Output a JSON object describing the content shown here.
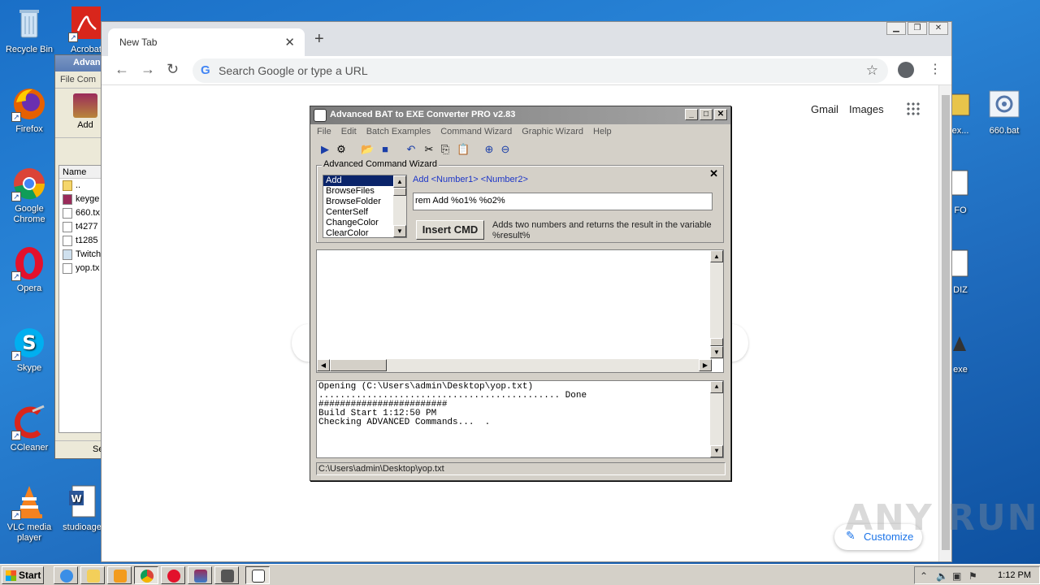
{
  "desktop": {
    "left_icons": [
      {
        "id": "recycle-bin",
        "label": "Recycle Bin",
        "icon": "recycle-bin-icon"
      },
      {
        "id": "acrobat",
        "label": "Acrobat",
        "icon": "acrobat-icon"
      },
      {
        "id": "firefox",
        "label": "Firefox",
        "icon": "firefox-icon"
      },
      {
        "id": "chrome",
        "label": "Google Chrome",
        "icon": "chrome-icon"
      },
      {
        "id": "opera",
        "label": "Opera",
        "icon": "opera-icon"
      },
      {
        "id": "skype",
        "label": "Skype",
        "icon": "skype-icon"
      },
      {
        "id": "ccleaner",
        "label": "CCleaner",
        "icon": "ccleaner-icon"
      },
      {
        "id": "vlc",
        "label": "VLC media player",
        "icon": "vlc-icon"
      },
      {
        "id": "studioage",
        "label": "studioage",
        "icon": "word-document-icon"
      }
    ],
    "right_icons": [
      {
        "id": "ex",
        "label": "ex..."
      },
      {
        "id": "660bat",
        "label": "660.bat"
      },
      {
        "id": "fo",
        "label": "FO"
      },
      {
        "id": "diz",
        "label": "DIZ"
      },
      {
        "id": "exe",
        "label": "exe"
      }
    ]
  },
  "winrar": {
    "title": "Advan",
    "menu": "File  Com",
    "add_label": "Add",
    "col_name": "Name",
    "files": [
      "..",
      "keyge",
      "660.tx",
      "t4277",
      "t1285",
      "Twitch",
      "yop.tx"
    ],
    "status": "Se"
  },
  "chrome": {
    "tab_title": "New Tab",
    "omnibox_placeholder": "Search Google or type a URL",
    "gmail": "Gmail",
    "images": "Images",
    "customize": "Customize"
  },
  "bat2exe": {
    "title": "Advanced BAT to EXE Converter PRO v2.83",
    "menu": [
      "File",
      "Edit",
      "Batch Examples",
      "Command Wizard",
      "Graphic Wizard",
      "Help"
    ],
    "wizard_legend": "Advanced Command Wizard",
    "commands": [
      "Add",
      "BrowseFiles",
      "BrowseFolder",
      "CenterSelf",
      "ChangeColor",
      "ClearColor"
    ],
    "selected_command": "Add",
    "syntax": "Add  <Number1> <Number2>",
    "command_input": "rem Add %o1% %o2%",
    "insert_button": "Insert CMD",
    "description": "Adds two numbers and returns the result in the variable %result%",
    "log": [
      "Opening (C:\\Users\\admin\\Desktop\\yop.txt)",
      "............................................. Done",
      "########################",
      "Build Start 1:12:50 PM",
      "Checking ADVANCED Commands...  ."
    ],
    "status": "C:\\Users\\admin\\Desktop\\yop.txt"
  },
  "watermark": "ANY RUN",
  "taskbar": {
    "start": "Start",
    "clock": "1:12 PM"
  },
  "colors": {
    "selection": "#0a246a",
    "link_blue": "#1c35c7",
    "desktop": "#1f6bbd"
  }
}
